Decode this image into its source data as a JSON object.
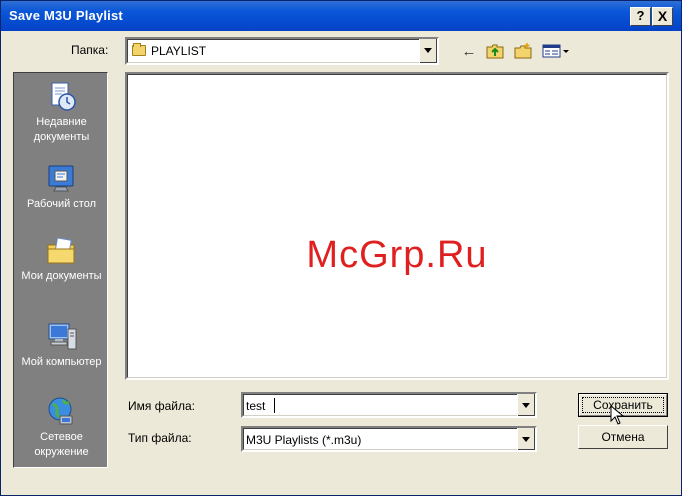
{
  "window": {
    "title": "Save M3U Playlist",
    "help_glyph": "?",
    "close_glyph": "X"
  },
  "location": {
    "label": "Папка:",
    "current_folder": "PLAYLIST"
  },
  "toolbar": {
    "back_glyph": "←"
  },
  "places": [
    {
      "label": "Недавние документы",
      "icon": "recent-documents-icon"
    },
    {
      "label": "Рабочий стол",
      "icon": "desktop-icon"
    },
    {
      "label": "Мои документы",
      "icon": "my-documents-icon"
    },
    {
      "label": "Мой компьютер",
      "icon": "my-computer-icon"
    },
    {
      "label": "Сетевое окружение",
      "icon": "network-places-icon"
    }
  ],
  "watermark": "McGrp.Ru",
  "form": {
    "filename_label": "Имя файла:",
    "filename_value": "test",
    "filetype_label": "Тип файла:",
    "filetype_value": "M3U Playlists (*.m3u)"
  },
  "buttons": {
    "save": "Сохранить",
    "cancel": "Отмена"
  },
  "colors": {
    "titlebar": "#0a56d8",
    "window_bg": "#ece9d8",
    "sidebar_bg": "#808080",
    "watermark": "#e02020"
  }
}
